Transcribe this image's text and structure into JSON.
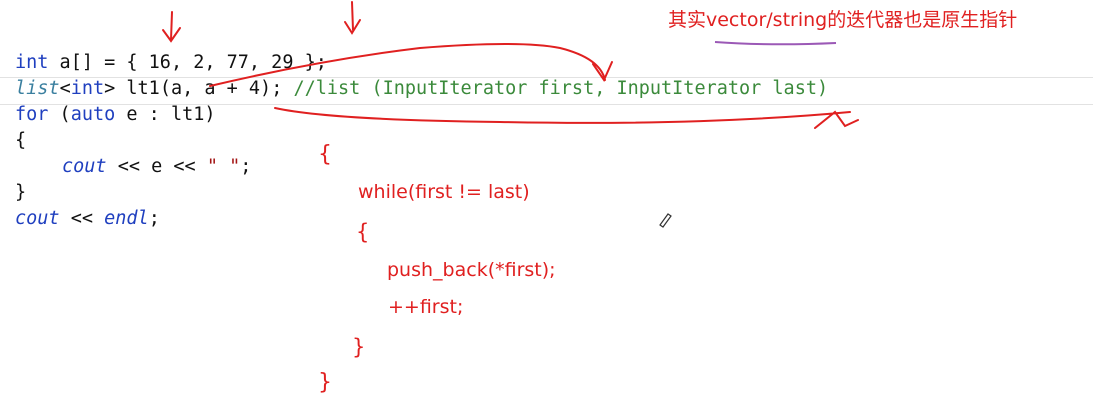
{
  "annotation_title": "其实vector/string的迭代器也是原生指针",
  "code": {
    "line1": {
      "type": "int",
      "rest": " a[] = { 16, 2, 77, 29 };"
    },
    "line2": {
      "type": "list",
      "lt": "<",
      "int": "int",
      "gt": ">",
      "rest": " lt1(a, a + 4); ",
      "comment": "//list (InputIterator first, InputIterator last)"
    },
    "line3": {
      "for": "for",
      "open": " (",
      "auto": "auto",
      "rest": " e : lt1)"
    },
    "line4": "{",
    "line5": {
      "cout": "cout",
      "mid": " << e << ",
      "str": "\" \"",
      "end": ";"
    },
    "line6": "}",
    "line7": {
      "cout": "cout",
      "mid": " << ",
      "endl": "endl",
      "end": ";"
    }
  },
  "handwritten": {
    "brace_open": "{",
    "while": "while(first != last)",
    "inner_open": "{",
    "push": "push_back(*first);",
    "inc": "++first;",
    "inner_close": "}",
    "brace_close": "}"
  }
}
